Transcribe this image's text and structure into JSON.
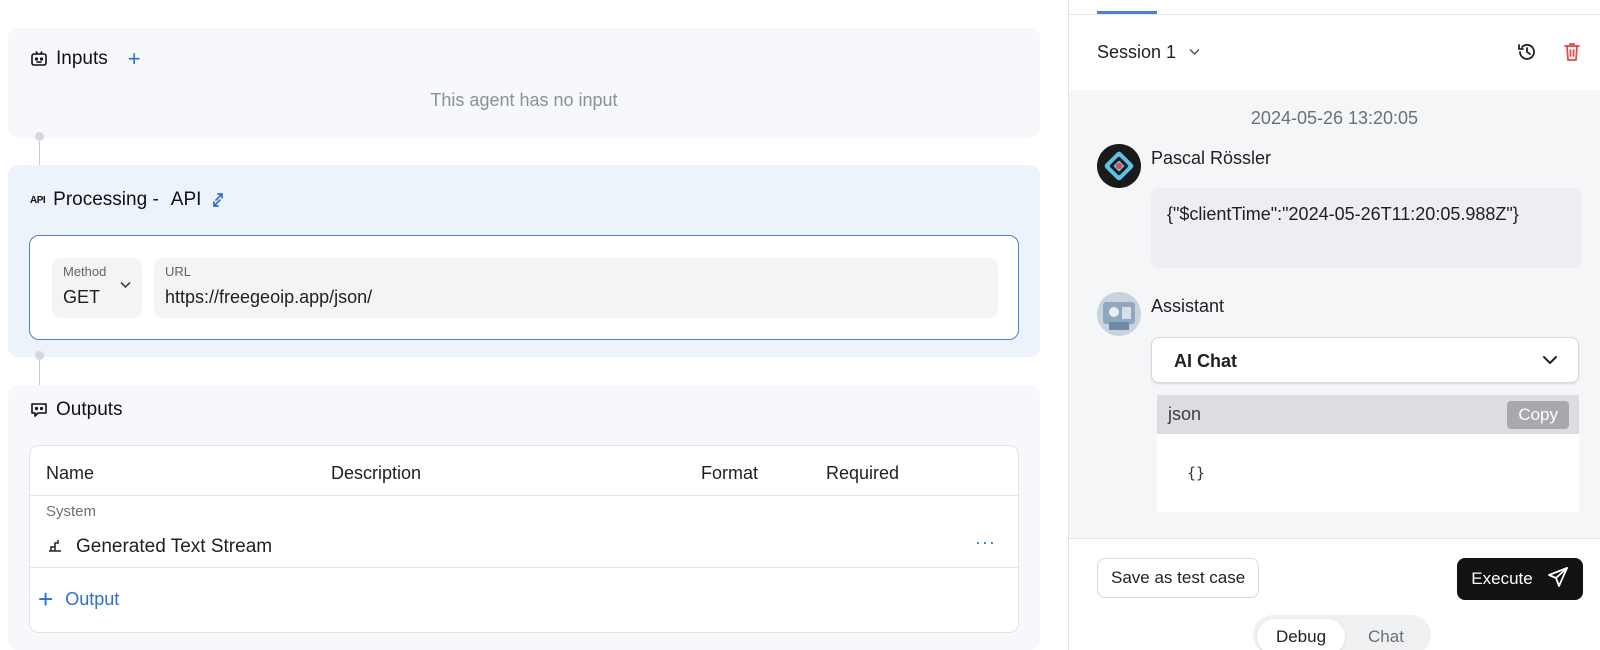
{
  "inputs": {
    "title": "Inputs",
    "add_icon": "plus-icon",
    "empty_text": "This agent has no input"
  },
  "processing": {
    "badge": "API",
    "title": "Processing -",
    "type_label": "API",
    "switch_icon": "swap-arrows-icon",
    "method_label": "Method",
    "method_value": "GET",
    "url_label": "URL",
    "url_value": "https://freegeoip.app/json/"
  },
  "outputs": {
    "title": "Outputs",
    "columns": [
      "Name",
      "Description",
      "Format",
      "Required"
    ],
    "group_label": "System",
    "rows": [
      {
        "name": "Generated Text Stream",
        "icon": "text-stream-icon",
        "more": "···"
      }
    ],
    "add_label": "Output"
  },
  "session": {
    "label": "Session 1",
    "history_icon": "history-icon",
    "delete_icon": "trash-icon"
  },
  "chat": {
    "timestamp": "2024-05-26 13:20:05",
    "user_name": "Pascal Rössler",
    "user_message": "{\"$clientTime\":\"2024-05-26T11:20:05.988Z\"}",
    "assistant_name": "Assistant",
    "block_title": "AI Chat",
    "code_lang": "json",
    "copy_label": "Copy",
    "code_content": "{}"
  },
  "footer": {
    "save_label": "Save as test case",
    "execute_label": "Execute",
    "modes": [
      "Debug",
      "Chat"
    ]
  },
  "colors": {
    "accent": "#2f6fd1",
    "danger": "#e5484d",
    "execute_bg": "#111213"
  }
}
